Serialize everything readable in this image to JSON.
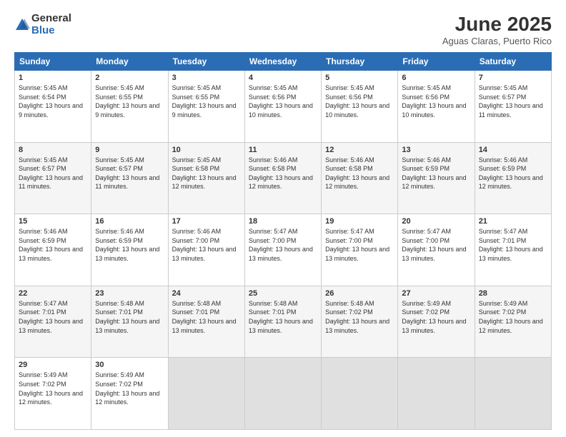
{
  "logo": {
    "general": "General",
    "blue": "Blue"
  },
  "title": "June 2025",
  "subtitle": "Aguas Claras, Puerto Rico",
  "headers": [
    "Sunday",
    "Monday",
    "Tuesday",
    "Wednesday",
    "Thursday",
    "Friday",
    "Saturday"
  ],
  "weeks": [
    [
      {
        "day": "1",
        "sunrise": "5:45 AM",
        "sunset": "6:54 PM",
        "daylight": "13 hours and 9 minutes."
      },
      {
        "day": "2",
        "sunrise": "5:45 AM",
        "sunset": "6:55 PM",
        "daylight": "13 hours and 9 minutes."
      },
      {
        "day": "3",
        "sunrise": "5:45 AM",
        "sunset": "6:55 PM",
        "daylight": "13 hours and 9 minutes."
      },
      {
        "day": "4",
        "sunrise": "5:45 AM",
        "sunset": "6:56 PM",
        "daylight": "13 hours and 10 minutes."
      },
      {
        "day": "5",
        "sunrise": "5:45 AM",
        "sunset": "6:56 PM",
        "daylight": "13 hours and 10 minutes."
      },
      {
        "day": "6",
        "sunrise": "5:45 AM",
        "sunset": "6:56 PM",
        "daylight": "13 hours and 10 minutes."
      },
      {
        "day": "7",
        "sunrise": "5:45 AM",
        "sunset": "6:57 PM",
        "daylight": "13 hours and 11 minutes."
      }
    ],
    [
      {
        "day": "8",
        "sunrise": "5:45 AM",
        "sunset": "6:57 PM",
        "daylight": "13 hours and 11 minutes."
      },
      {
        "day": "9",
        "sunrise": "5:45 AM",
        "sunset": "6:57 PM",
        "daylight": "13 hours and 11 minutes."
      },
      {
        "day": "10",
        "sunrise": "5:45 AM",
        "sunset": "6:58 PM",
        "daylight": "13 hours and 12 minutes."
      },
      {
        "day": "11",
        "sunrise": "5:46 AM",
        "sunset": "6:58 PM",
        "daylight": "13 hours and 12 minutes."
      },
      {
        "day": "12",
        "sunrise": "5:46 AM",
        "sunset": "6:58 PM",
        "daylight": "13 hours and 12 minutes."
      },
      {
        "day": "13",
        "sunrise": "5:46 AM",
        "sunset": "6:59 PM",
        "daylight": "13 hours and 12 minutes."
      },
      {
        "day": "14",
        "sunrise": "5:46 AM",
        "sunset": "6:59 PM",
        "daylight": "13 hours and 12 minutes."
      }
    ],
    [
      {
        "day": "15",
        "sunrise": "5:46 AM",
        "sunset": "6:59 PM",
        "daylight": "13 hours and 13 minutes."
      },
      {
        "day": "16",
        "sunrise": "5:46 AM",
        "sunset": "6:59 PM",
        "daylight": "13 hours and 13 minutes."
      },
      {
        "day": "17",
        "sunrise": "5:46 AM",
        "sunset": "7:00 PM",
        "daylight": "13 hours and 13 minutes."
      },
      {
        "day": "18",
        "sunrise": "5:47 AM",
        "sunset": "7:00 PM",
        "daylight": "13 hours and 13 minutes."
      },
      {
        "day": "19",
        "sunrise": "5:47 AM",
        "sunset": "7:00 PM",
        "daylight": "13 hours and 13 minutes."
      },
      {
        "day": "20",
        "sunrise": "5:47 AM",
        "sunset": "7:00 PM",
        "daylight": "13 hours and 13 minutes."
      },
      {
        "day": "21",
        "sunrise": "5:47 AM",
        "sunset": "7:01 PM",
        "daylight": "13 hours and 13 minutes."
      }
    ],
    [
      {
        "day": "22",
        "sunrise": "5:47 AM",
        "sunset": "7:01 PM",
        "daylight": "13 hours and 13 minutes."
      },
      {
        "day": "23",
        "sunrise": "5:48 AM",
        "sunset": "7:01 PM",
        "daylight": "13 hours and 13 minutes."
      },
      {
        "day": "24",
        "sunrise": "5:48 AM",
        "sunset": "7:01 PM",
        "daylight": "13 hours and 13 minutes."
      },
      {
        "day": "25",
        "sunrise": "5:48 AM",
        "sunset": "7:01 PM",
        "daylight": "13 hours and 13 minutes."
      },
      {
        "day": "26",
        "sunrise": "5:48 AM",
        "sunset": "7:02 PM",
        "daylight": "13 hours and 13 minutes."
      },
      {
        "day": "27",
        "sunrise": "5:49 AM",
        "sunset": "7:02 PM",
        "daylight": "13 hours and 13 minutes."
      },
      {
        "day": "28",
        "sunrise": "5:49 AM",
        "sunset": "7:02 PM",
        "daylight": "13 hours and 12 minutes."
      }
    ],
    [
      {
        "day": "29",
        "sunrise": "5:49 AM",
        "sunset": "7:02 PM",
        "daylight": "13 hours and 12 minutes."
      },
      {
        "day": "30",
        "sunrise": "5:49 AM",
        "sunset": "7:02 PM",
        "daylight": "13 hours and 12 minutes."
      },
      null,
      null,
      null,
      null,
      null
    ]
  ]
}
